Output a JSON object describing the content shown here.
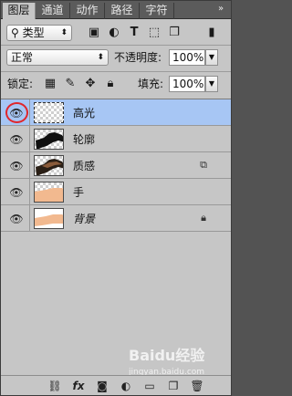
{
  "tabs": [
    {
      "label": "图层",
      "active": true
    },
    {
      "label": "通道",
      "active": false
    },
    {
      "label": "动作",
      "active": false
    },
    {
      "label": "路径",
      "active": false
    },
    {
      "label": "字符",
      "active": false
    }
  ],
  "tab_menu_icon": "double-arrow-menu-icon",
  "filter": {
    "kind_label": "类型",
    "icons": [
      "image-filter-icon",
      "adjustment-filter-icon",
      "type-filter-icon",
      "shape-filter-icon",
      "smart-object-filter-icon"
    ]
  },
  "blend": {
    "mode": "正常",
    "opacity_label": "不透明度:",
    "opacity_value": "100%"
  },
  "lock": {
    "label": "锁定:",
    "icons": [
      "lock-transparent-icon",
      "lock-image-icon",
      "lock-position-icon",
      "lock-all-icon"
    ],
    "fill_label": "填充:",
    "fill_value": "100%"
  },
  "layers": [
    {
      "name": "高光",
      "visible": true,
      "selected": true,
      "thumb": "transparent",
      "badge": ""
    },
    {
      "name": "轮廓",
      "visible": true,
      "selected": false,
      "thumb": "silhouette",
      "badge": ""
    },
    {
      "name": "质感",
      "visible": true,
      "selected": false,
      "thumb": "texture",
      "badge": "smart-object-icon"
    },
    {
      "name": "手",
      "visible": true,
      "selected": false,
      "thumb": "hand",
      "badge": ""
    },
    {
      "name": "背景",
      "visible": true,
      "selected": false,
      "thumb": "background",
      "badge": "lock-icon"
    }
  ],
  "bottom_icons": [
    "link-layers-icon",
    "fx-icon",
    "add-mask-icon",
    "adjustment-layer-icon",
    "new-group-icon",
    "new-layer-icon",
    "delete-layer-icon"
  ],
  "fx_label": "fx",
  "watermark": {
    "main": "Baidu经验",
    "sub": "jingyan.baidu.com"
  }
}
